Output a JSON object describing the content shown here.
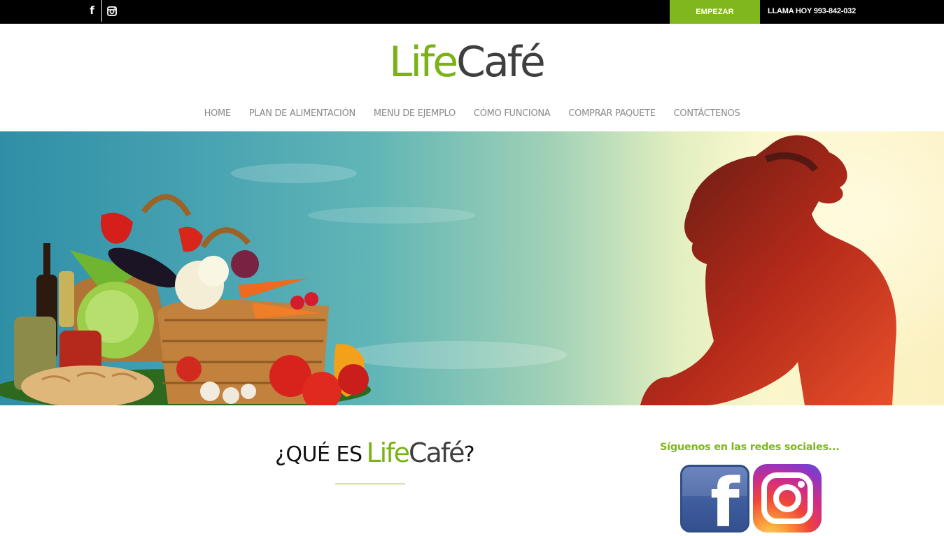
{
  "topbar": {
    "social": [
      {
        "icon": "facebook-icon"
      },
      {
        "icon": "instagram-icon"
      }
    ],
    "cta_label": "EMPEZAR",
    "call_text": "LLAMA HOY 993-842-032"
  },
  "logo": {
    "part1": "Life",
    "part2": "Café"
  },
  "nav": {
    "items": [
      {
        "label": "HOME"
      },
      {
        "label": "PLAN DE ALIMENTACIÓN"
      },
      {
        "label": "MENU DE EJEMPLO"
      },
      {
        "label": "CÓMO FUNCIONA"
      },
      {
        "label": "COMPRAR PAQUETE"
      },
      {
        "label": "CONTÁCTENOS"
      }
    ]
  },
  "about": {
    "prefix": "¿QUÉ ES",
    "logo_part1": "Life",
    "logo_part2": "Café",
    "suffix": "?"
  },
  "social_section": {
    "title": "Síguenos en las redes sociales...",
    "facebook_icon": "facebook-icon",
    "instagram_icon": "instagram-icon"
  },
  "colors": {
    "brand_green": "#80b71c",
    "topbar": "#000000",
    "nav_text": "#8a8a8a"
  }
}
